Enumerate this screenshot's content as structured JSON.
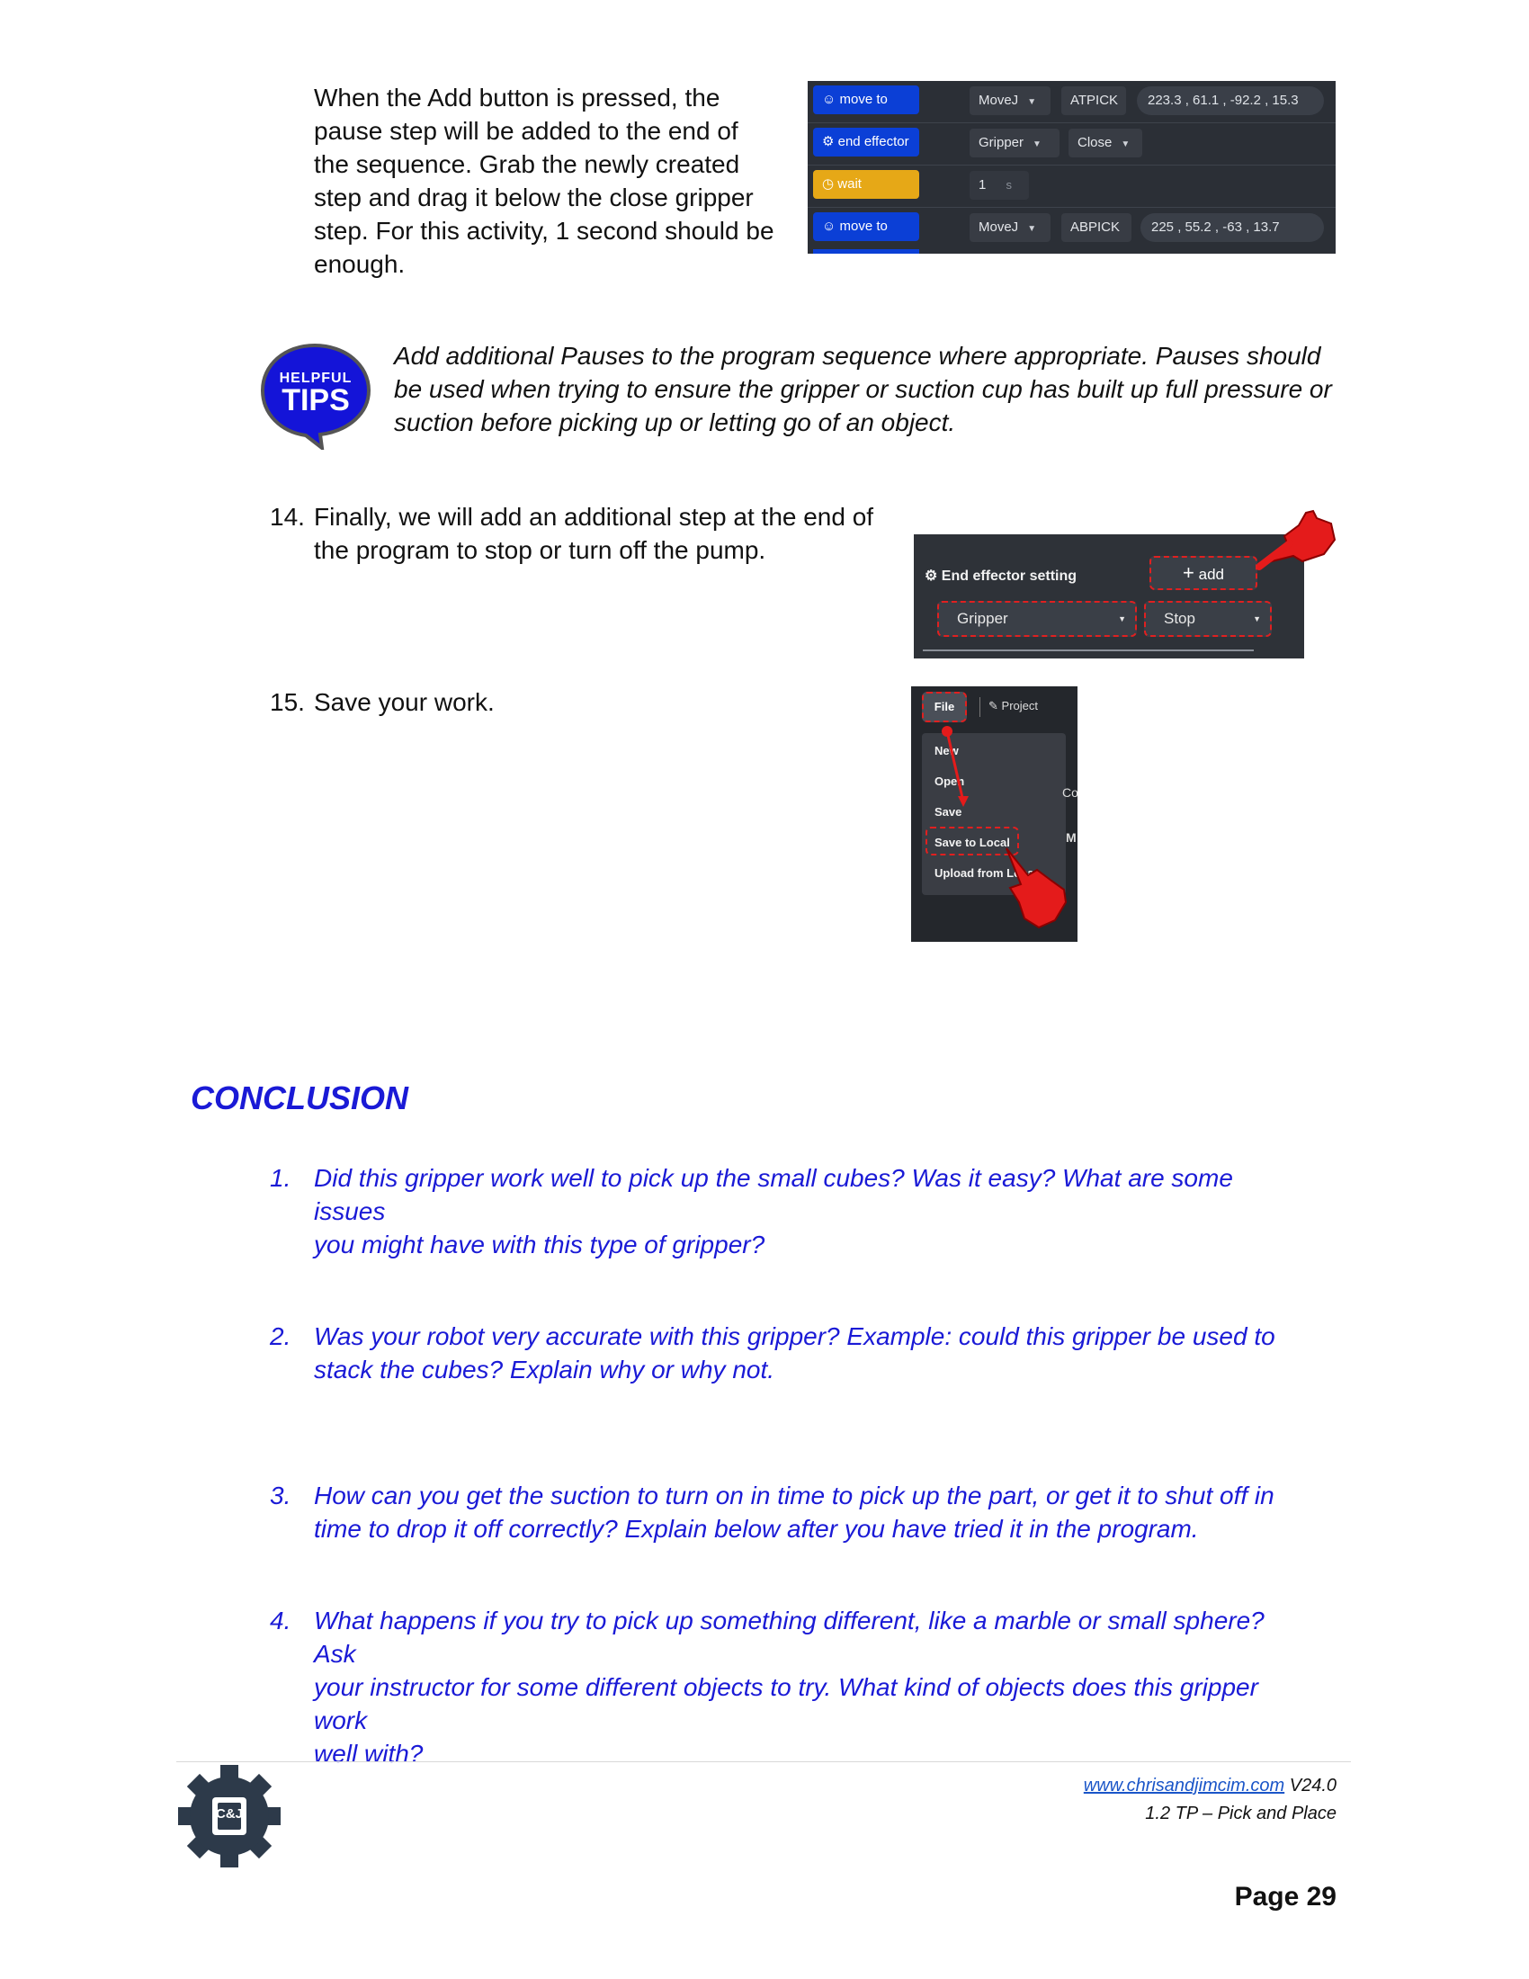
{
  "step13": {
    "lines": [
      "When the Add button is pressed, the",
      "pause step will be added to the end of",
      "the sequence.  Grab the newly created",
      "step and drag it below the close gripper",
      "step. For this activity, 1 second should be",
      "enough."
    ]
  },
  "sequence_ui": {
    "rows": [
      {
        "block": "move to",
        "block_icon": "robot-arm-icon",
        "color": "#0b3fd6",
        "fields": [
          "MoveJ",
          "ATPICK",
          "223.3 ,  61.1 ,  -92.2 ,  15.3"
        ]
      },
      {
        "block": "end effector",
        "block_icon": "gripper-icon",
        "color": "#0b3fd6",
        "fields": [
          "Gripper",
          "Close"
        ]
      },
      {
        "block": "wait",
        "block_icon": "clock-icon",
        "color": "#e6a817",
        "fields": [
          "1",
          "s"
        ]
      },
      {
        "block": "move to",
        "block_icon": "robot-arm-icon",
        "color": "#0b3fd6",
        "fields": [
          "MoveJ",
          "ABPICK",
          "225  ,  55.2  ,   -63  ,  13.7"
        ]
      }
    ]
  },
  "tips": {
    "badge_top": "HELPFUL",
    "badge_main": "TIPS",
    "lines": [
      "Add additional Pauses to the program sequence where appropriate. Pauses should",
      "be used when trying to ensure the gripper or suction cup has built up full pressure or",
      "suction before picking up or letting go of an object."
    ]
  },
  "step14": {
    "number": "14.",
    "lines": [
      "Finally, we will add an additional step at the end of",
      "the program to stop or turn off the pump."
    ]
  },
  "effector_ui": {
    "title": "End effector setting",
    "add_label": "add",
    "type_value": "Gripper",
    "action_value": "Stop"
  },
  "step15": {
    "number": "15.",
    "text": "Save your work."
  },
  "file_menu_ui": {
    "file_tab": "File",
    "project_tab": "Project",
    "items": [
      "New",
      "Open",
      "Save",
      "Save to Local",
      "Upload from Local"
    ],
    "side_peek": [
      "Co",
      "M"
    ]
  },
  "conclusion": {
    "heading": "CONCLUSION",
    "questions": [
      {
        "n": "1.",
        "lines": [
          "Did this gripper work well to pick up the small cubes? Was it easy? What are some issues",
          "you might have with this type of gripper?"
        ]
      },
      {
        "n": "2.",
        "lines": [
          "Was your robot very accurate with this gripper? Example: could this gripper be used to",
          "stack the cubes? Explain why or why not."
        ]
      },
      {
        "n": "3.",
        "lines": [
          "How can you get the suction to turn on in time to pick up the part, or get it to shut off in",
          "time to drop it off correctly? Explain below after you have tried it in the program."
        ]
      },
      {
        "n": "4.",
        "lines": [
          "What happens if you try to pick up something different, like a marble or small sphere? Ask",
          "your instructor for some different objects to try. What kind of objects does this gripper work",
          "well with?"
        ]
      }
    ]
  },
  "footer": {
    "logo_text": "C&J",
    "url": "www.chrisandjimcim.com",
    "version": "V24.0",
    "section": "1.2   TP – Pick and Place",
    "page": "Page 29"
  }
}
